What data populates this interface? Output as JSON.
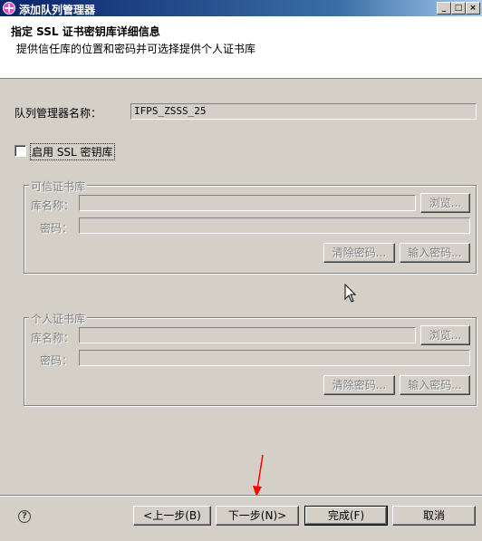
{
  "window": {
    "title": "添加队列管理器",
    "minimize_glyph": "_",
    "maximize_glyph": "□",
    "close_glyph": "×"
  },
  "header": {
    "title": "指定 SSL 证书密钥库详细信息",
    "description": "提供信任库的位置和密码并可选择提供个人证书库"
  },
  "form": {
    "qmgr_label": "队列管理器名称：",
    "qmgr_value": "IFPS_ZSSS_25",
    "ssl_checkbox_label": "启用 SSL 密钥库"
  },
  "trusted_store": {
    "legend": "可信证书库",
    "name_label": "库名称：",
    "password_label": "密码：",
    "browse_label": "浏览...",
    "clear_password_label": "清除密码...",
    "enter_password_label": "输入密码..."
  },
  "personal_store": {
    "legend": "个人证书库",
    "name_label": "库名称：",
    "password_label": "密码：",
    "browse_label": "浏览...",
    "clear_password_label": "清除密码...",
    "enter_password_label": "输入密码..."
  },
  "footer": {
    "help_glyph": "?",
    "back_label": "<上一步(B)",
    "next_label": "下一步(N)>",
    "finish_label": "完成(F)",
    "cancel_label": "取消"
  },
  "colors": {
    "dialog_bg": "#d4d0c8",
    "annotation_arrow": "#ff0000"
  }
}
